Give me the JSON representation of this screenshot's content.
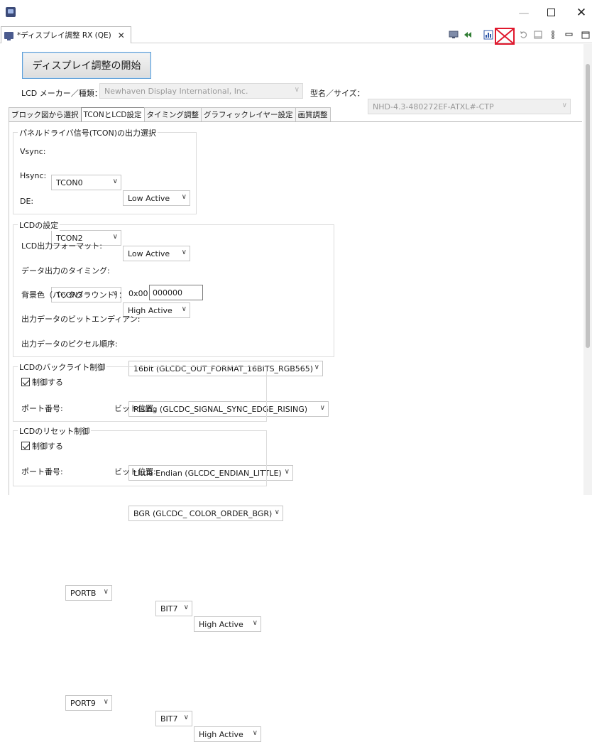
{
  "window": {
    "minimize_glyph": "—",
    "close_glyph": "✕"
  },
  "editor_tab": {
    "title": "*ディスプレイ調整 RX (QE)",
    "close_glyph": "✕"
  },
  "toolbar_icons": [
    "monitor-icon",
    "rewind-icon",
    "chart-icon",
    "disconnect-icon",
    "refresh-icon",
    "window-icon",
    "vertical-dots-icon",
    "minimize-view-icon",
    "maximize-view-icon"
  ],
  "highlight_color": "#e0182d",
  "start_button": {
    "label": "ディスプレイ調整の開始"
  },
  "lcd_maker": {
    "label": "LCD メーカー／種類：",
    "value": "Newhaven Display International, Inc."
  },
  "model": {
    "label": "型名／サイズ：",
    "value": "NHD-4.3-480272EF-ATXL#-CTP"
  },
  "tabs": [
    {
      "label": "ブロック図から選択",
      "selected": false
    },
    {
      "label": "TCONとLCD設定",
      "selected": true
    },
    {
      "label": "タイミング調整",
      "selected": false
    },
    {
      "label": "グラフィックレイヤー設定",
      "selected": false
    },
    {
      "label": "画質調整",
      "selected": false
    }
  ],
  "tcon_group": {
    "title": "パネルドライバ信号(TCON)の出力選択",
    "rows": [
      {
        "label": "Vsync:",
        "tcon": "TCON0",
        "polarity": "Low Active"
      },
      {
        "label": "Hsync:",
        "tcon": "TCON2",
        "polarity": "Low Active"
      },
      {
        "label": "DE:",
        "tcon": "TCON3",
        "polarity": "High Active"
      }
    ]
  },
  "lcd_settings": {
    "title": "LCDの設定",
    "output_format": {
      "label": "LCD出力フォーマット:",
      "value": "16bit (GLCDC_OUT_FORMAT_16BITS_RGB565)"
    },
    "output_timing": {
      "label": "データ出力のタイミング:",
      "value": "Rising (GLCDC_SIGNAL_SYNC_EDGE_RISING)"
    },
    "background": {
      "label": "背景色（バックグラウンド）：",
      "prefix": "0x00",
      "value": "000000"
    },
    "endian": {
      "label": "出力データのビットエンディアン:",
      "value": "Little Endian (GLCDC_ENDIAN_LITTLE)"
    },
    "pixel_order": {
      "label": "出力データのピクセル順序:",
      "value": "BGR (GLCDC_ COLOR_ORDER_BGR)"
    }
  },
  "backlight": {
    "title": "LCDのバックライト制御",
    "checkbox_label": "制御する",
    "checked": true,
    "port_label": "ポート番号:",
    "port": "PORTB",
    "bit_label": "ビット位置:",
    "bit": "BIT7",
    "polarity": "High Active"
  },
  "reset": {
    "title": "LCDのリセット制御",
    "checkbox_label": "制御する",
    "checked": true,
    "port_label": "ポート番号:",
    "port": "PORT9",
    "bit_label": "ビット位置:",
    "bit": "BIT7",
    "polarity": "High Active"
  }
}
